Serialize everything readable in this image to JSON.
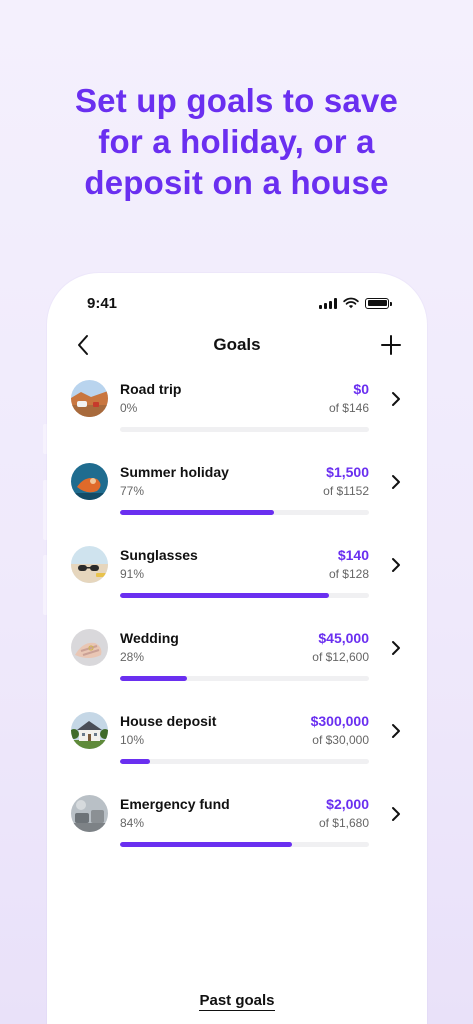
{
  "headline": "Set up goals to save for a holiday, or a deposit on a house",
  "status_bar": {
    "time": "9:41"
  },
  "nav": {
    "title": "Goals",
    "back_icon": "chevron-left-icon",
    "add_icon": "plus-icon"
  },
  "goals": [
    {
      "name": "Road trip",
      "percent_label": "0%",
      "amount": "$0",
      "of_label": "of $146",
      "progress": 0,
      "image": "road-trip-photo"
    },
    {
      "name": "Summer holiday",
      "percent_label": "77%",
      "amount": "$1,500",
      "of_label": "of $1152",
      "progress": 0.62,
      "image": "summer-holiday-photo"
    },
    {
      "name": "Sunglasses",
      "percent_label": "91%",
      "amount": "$140",
      "of_label": "of $128",
      "progress": 0.84,
      "image": "sunglasses-photo"
    },
    {
      "name": "Wedding",
      "percent_label": "28%",
      "amount": "$45,000",
      "of_label": "of $12,600",
      "progress": 0.27,
      "image": "wedding-photo"
    },
    {
      "name": "House deposit",
      "percent_label": "10%",
      "amount": "$300,000",
      "of_label": "of $30,000",
      "progress": 0.12,
      "image": "house-photo"
    },
    {
      "name": "Emergency fund",
      "percent_label": "84%",
      "amount": "$2,000",
      "of_label": "of $1,680",
      "progress": 0.69,
      "image": "emergency-fund-photo"
    }
  ],
  "footer": {
    "past_goals_label": "Past goals"
  },
  "colors": {
    "accent": "#6a2ff0",
    "track": "#f0f0f2"
  }
}
